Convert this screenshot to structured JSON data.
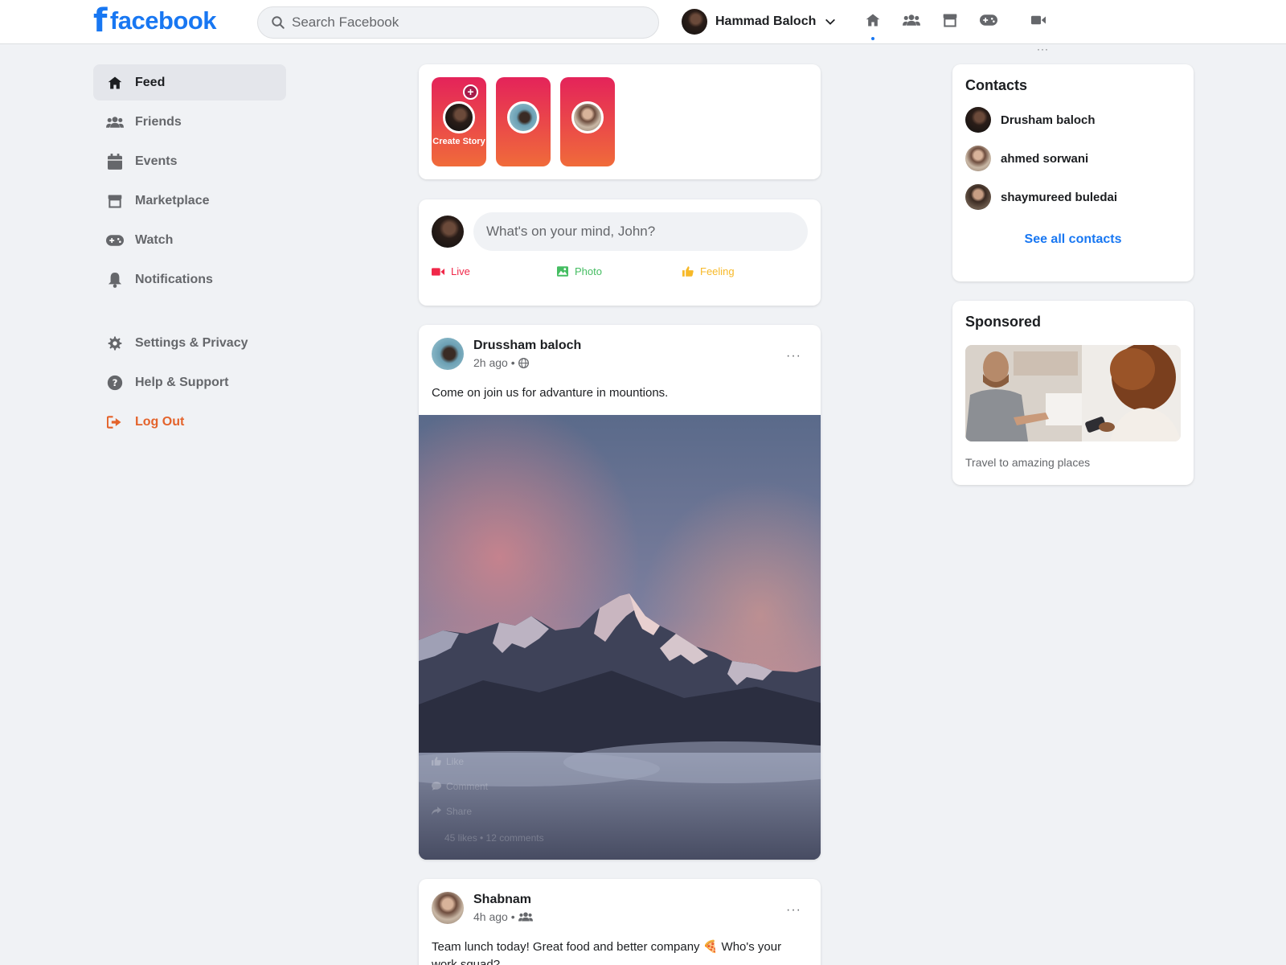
{
  "header": {
    "logo_text": "facebook",
    "search_placeholder": "Search Facebook",
    "profile_name": "Hammad Baloch",
    "more_label": "···"
  },
  "sidebar": {
    "items": [
      {
        "label": "Feed",
        "icon": "home-icon"
      },
      {
        "label": "Friends",
        "icon": "friends-icon"
      },
      {
        "label": "Events",
        "icon": "calendar-icon"
      },
      {
        "label": "Marketplace",
        "icon": "store-icon"
      },
      {
        "label": "Watch",
        "icon": "gamepad-icon"
      },
      {
        "label": "Notifications",
        "icon": "bell-icon"
      }
    ],
    "secondary": [
      {
        "label": "Settings & Privacy",
        "icon": "gear-icon"
      },
      {
        "label": "Help & Support",
        "icon": "help-icon"
      },
      {
        "label": "Log Out",
        "icon": "logout-icon"
      }
    ]
  },
  "stories": {
    "create_label": "Create Story",
    "plus": "+"
  },
  "composer": {
    "placeholder": "What's on your mind, John?",
    "live_label": "Live",
    "photo_label": "Photo",
    "feeling_label": "Feeling"
  },
  "posts": [
    {
      "author": "Drussham baloch",
      "time": "2h ago •",
      "text": "Come on join us for advanture in mountions.",
      "more": "···",
      "like_label": "Like",
      "comment_label": "Comment",
      "share_label": "Share",
      "stats": "45 likes • 12 comments"
    },
    {
      "author": "Shabnam",
      "time": "4h ago •",
      "text": "Team lunch today! Great food and better company 🍕 Who's your work squad?",
      "more": "···"
    }
  ],
  "contacts": {
    "title": "Contacts",
    "items": [
      "Drusham baloch",
      "ahmed sorwani",
      "shaymureed buledai"
    ],
    "see_all": "See all contacts"
  },
  "sponsored": {
    "title": "Sponsored",
    "text": "Travel to amazing places"
  },
  "colors": {
    "brand": "#1877f2",
    "live": "#f02849",
    "photo": "#45bd62",
    "feeling": "#f7b928",
    "logout": "#e4632b"
  }
}
